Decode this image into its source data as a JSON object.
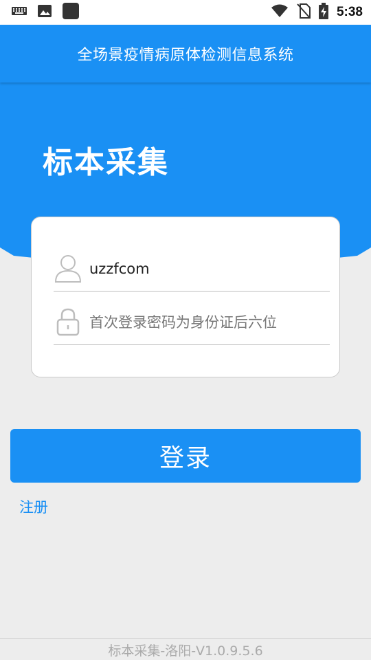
{
  "status_bar": {
    "time": "5:38",
    "icons": [
      "keyboard-icon",
      "image-icon",
      "square-notification-icon",
      "wifi-icon",
      "no-sim-icon",
      "battery-charging-icon"
    ]
  },
  "header": {
    "title": "全场景疫情病原体检测信息系统"
  },
  "hero": {
    "title": "标本采集"
  },
  "login_form": {
    "username_value": "uzzfcom",
    "password_placeholder": "首次登录密码为身份证后六位",
    "icons": [
      "user-icon",
      "lock-icon"
    ]
  },
  "actions": {
    "login_label": "登录",
    "register_label": "注册"
  },
  "footer": {
    "version_text": "标本采集-洛阳-V1.0.9.5.6"
  },
  "colors": {
    "primary": "#1a90f4",
    "background": "#ededed",
    "card": "#ffffff"
  }
}
